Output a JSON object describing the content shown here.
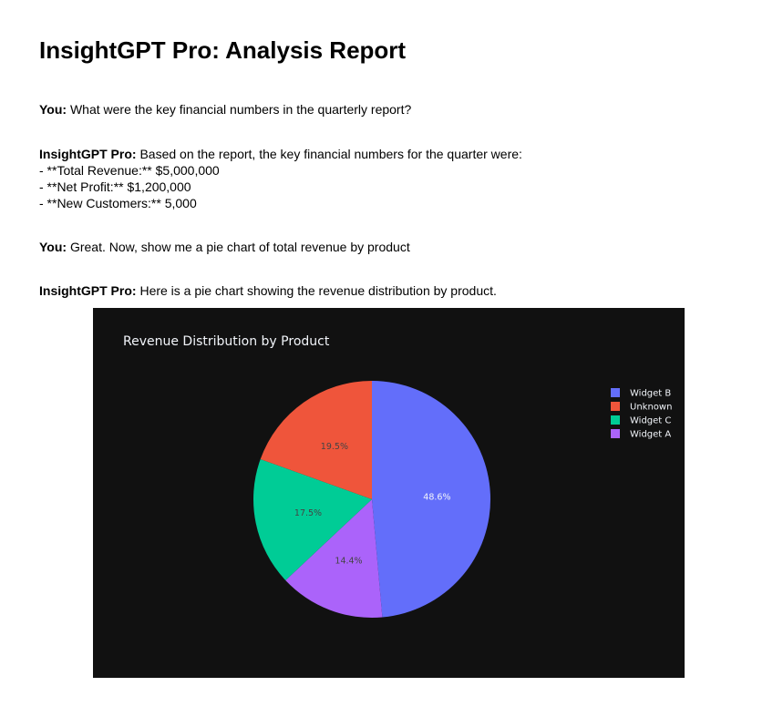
{
  "report": {
    "title": "InsightGPT Pro: Analysis Report"
  },
  "conversation": [
    {
      "speaker": "You:",
      "text": " What were the key financial numbers in the quarterly report?"
    },
    {
      "speaker": "InsightGPT Pro:",
      "text": " Based on the report, the key financial numbers for the quarter were:",
      "bullets": [
        "- **Total Revenue:** $5,000,000",
        "- **Net Profit:** $1,200,000",
        "- **New Customers:** 5,000"
      ]
    },
    {
      "speaker": "You:",
      "text": " Great. Now, show me a pie chart of total revenue by product"
    },
    {
      "speaker": "InsightGPT Pro:",
      "text": " Here is a pie chart showing the revenue distribution by product."
    }
  ],
  "chart_data": {
    "type": "pie",
    "title": "Revenue Distribution by Product",
    "background": "#111111",
    "legend_position": "top-right",
    "slices": [
      {
        "label": "Widget B",
        "value": 48.6,
        "text": "48.6%",
        "color": "#636efa",
        "text_color": "#f2f5fa"
      },
      {
        "label": "Widget A",
        "value": 14.4,
        "text": "14.4%",
        "color": "#ab63fa",
        "text_color": "#444444"
      },
      {
        "label": "Widget C",
        "value": 17.5,
        "text": "17.5%",
        "color": "#00cc96",
        "text_color": "#444444"
      },
      {
        "label": "Unknown",
        "value": 19.5,
        "text": "19.5%",
        "color": "#ef553b",
        "text_color": "#444444"
      }
    ],
    "legend_order": [
      "Widget B",
      "Unknown",
      "Widget C",
      "Widget A"
    ]
  }
}
